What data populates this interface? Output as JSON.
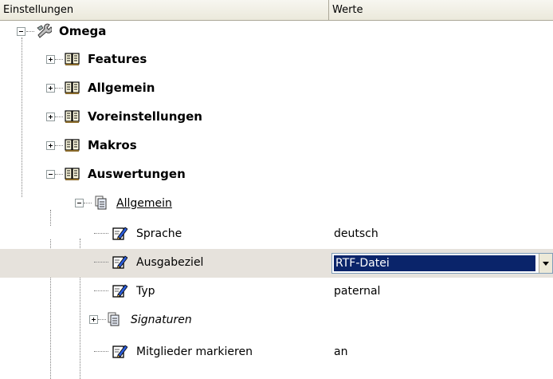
{
  "header": {
    "col_settings": "Einstellungen",
    "col_values": "Werte"
  },
  "tree": {
    "root": "Omega",
    "features": "Features",
    "allgemein": "Allgemein",
    "voreinstellungen": "Voreinstellungen",
    "makros": "Makros",
    "auswertungen": "Auswertungen",
    "ausw_allgemein": "Allgemein",
    "sprache": {
      "label": "Sprache",
      "value": "deutsch"
    },
    "ausgabeziel": {
      "label": "Ausgabeziel",
      "value": "RTF-Datei"
    },
    "typ": {
      "label": "Typ",
      "value": "paternal"
    },
    "signaturen": "Signaturen",
    "mitglieder": {
      "label": "Mitglieder markieren",
      "value": "an"
    }
  },
  "icons": {
    "root": "wrench-icon",
    "folder": "book-icon",
    "group": "pages-icon",
    "property": "pencil-document-icon"
  },
  "colors": {
    "selection": "#0a246a",
    "selected_row": "#e6e2dc"
  }
}
